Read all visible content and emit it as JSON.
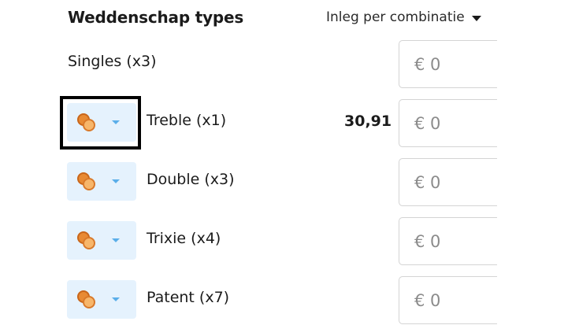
{
  "header": {
    "title": "Weddenschap types",
    "stake_mode_label": "Inleg per combinatie"
  },
  "currency_prefix": "€ 0",
  "rows": [
    {
      "label": "Singles (x3)",
      "odds": "",
      "stake_placeholder": "€ 0",
      "has_selector": false
    },
    {
      "label": "Treble (x1)",
      "odds": "30,91",
      "stake_placeholder": "€ 0",
      "has_selector": true,
      "focused": true
    },
    {
      "label": "Double (x3)",
      "odds": "",
      "stake_placeholder": "€ 0",
      "has_selector": true
    },
    {
      "label": "Trixie (x4)",
      "odds": "",
      "stake_placeholder": "€ 0",
      "has_selector": true
    },
    {
      "label": "Patent (x7)",
      "odds": "",
      "stake_placeholder": "€ 0",
      "has_selector": true
    }
  ],
  "icons": {
    "selector": "coins-icon",
    "dropdown": "chevron-down-icon"
  },
  "colors": {
    "pill_bg": "#e5f2fd",
    "caret": "#5aaee9",
    "coin": "#e88a33",
    "focus_ring": "#000000"
  }
}
